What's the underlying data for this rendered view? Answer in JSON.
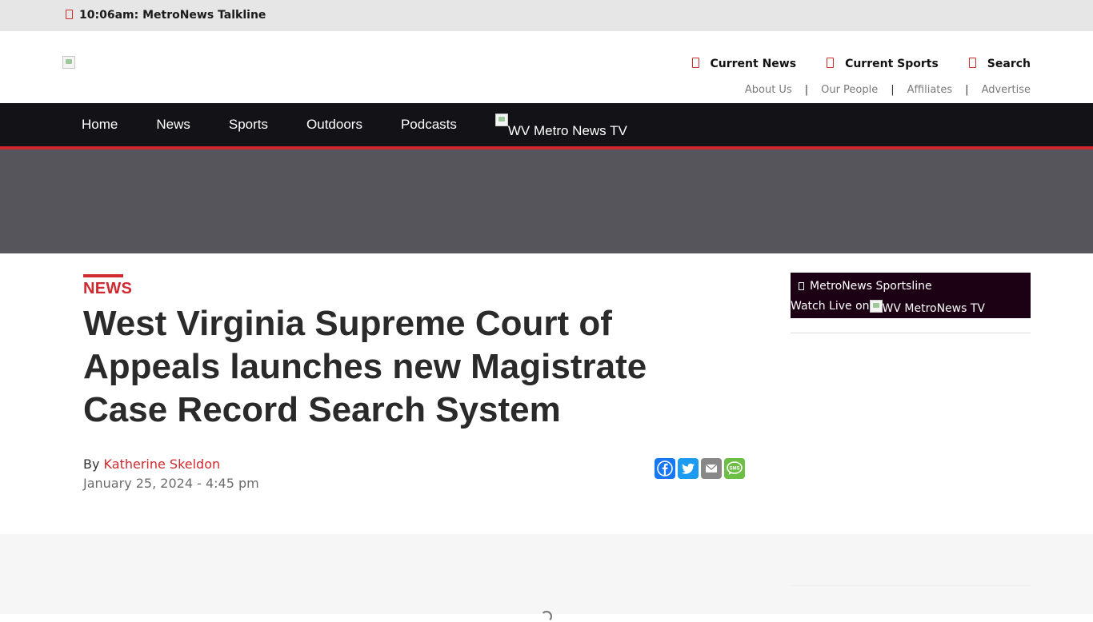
{
  "ticker": {
    "text": "10:06am: MetroNews Talkline",
    "icon": "radio-icon"
  },
  "header": {
    "logo_icon": "broken-image-icon",
    "quick_links": [
      {
        "label": "Current News",
        "icon": "document-icon"
      },
      {
        "label": "Current Sports",
        "icon": "document-icon"
      },
      {
        "label": "Search",
        "icon": "search-icon"
      }
    ],
    "util_links": [
      "About Us",
      "Our People",
      "Affiliates",
      "Advertise"
    ],
    "util_separator": "|"
  },
  "nav": {
    "items": [
      "Home",
      "News",
      "Sports",
      "Outdoors",
      "Podcasts"
    ],
    "tv_alt": "WV Metro News TV"
  },
  "article": {
    "category": "NEWS",
    "headline": "West Virginia Supreme Court of Appeals launches new Magistrate Case Record Search System",
    "by_prefix": "By",
    "author": "Katherine Skeldon",
    "date": "January 25, 2024 - 4:45 pm",
    "share": [
      "Facebook",
      "Twitter",
      "Email",
      "SMS"
    ],
    "sms_text": "SMS"
  },
  "sidebar": {
    "now_playing": "MetroNews Sportsline",
    "watch_prefix": "Watch Live on",
    "tv_alt": "WV MetroNews TV"
  },
  "colors": {
    "accent_red": "#cf2a2f",
    "nav_bg": "#131317",
    "ad_band": "#55555b",
    "sidebar_bg": "#1c0013",
    "facebook": "#1877f2",
    "twitter": "#1d9bf0",
    "email": "#888888",
    "sms": "#6cbe45"
  }
}
